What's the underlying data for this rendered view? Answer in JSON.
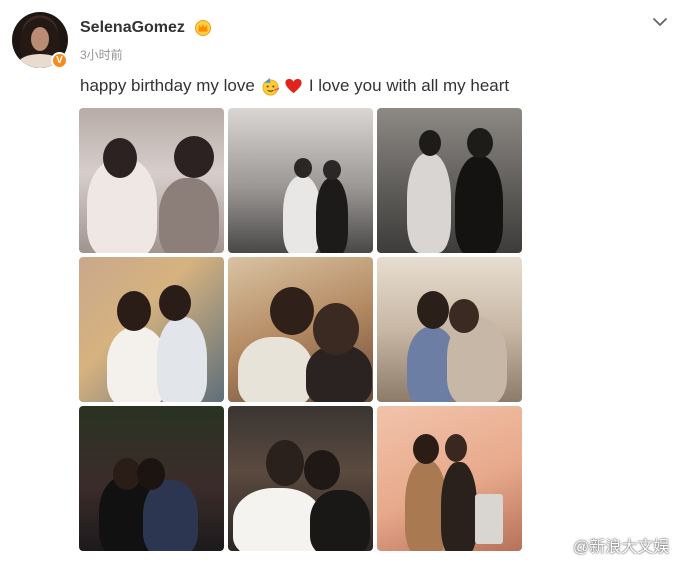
{
  "post": {
    "username": "SelenaGomez",
    "timestamp": "3小时前",
    "text_before": "happy birthday my love",
    "text_after": "I love you with all my heart",
    "emojis": [
      "partying-face-emoji",
      "red-heart-emoji"
    ],
    "badge_icon": "crown-icon",
    "verified_icon": "verified-v-icon",
    "verified_label": "V",
    "menu_icon": "chevron-down-icon"
  },
  "photos": [
    {
      "id": "photo-1",
      "label": "couple portrait, pink-toned black and white"
    },
    {
      "id": "photo-2",
      "label": "wedding aisle walk in white tent"
    },
    {
      "id": "photo-3",
      "label": "couple walking, black and white"
    },
    {
      "id": "photo-4",
      "label": "embrace on porch, sunny"
    },
    {
      "id": "photo-5",
      "label": "close selfie, warm tones"
    },
    {
      "id": "photo-6",
      "label": "hug in kitchen"
    },
    {
      "id": "photo-7",
      "label": "kiss at night party"
    },
    {
      "id": "photo-8",
      "label": "couple in feathered dress"
    },
    {
      "id": "photo-9",
      "label": "couple in peach room"
    }
  ],
  "watermark": {
    "text": "@新浪大文娱",
    "icon": "weibo-logo-icon"
  },
  "colors": {
    "accent_orange": "#f78b1e",
    "text_primary": "#333333",
    "text_muted": "#939393"
  }
}
